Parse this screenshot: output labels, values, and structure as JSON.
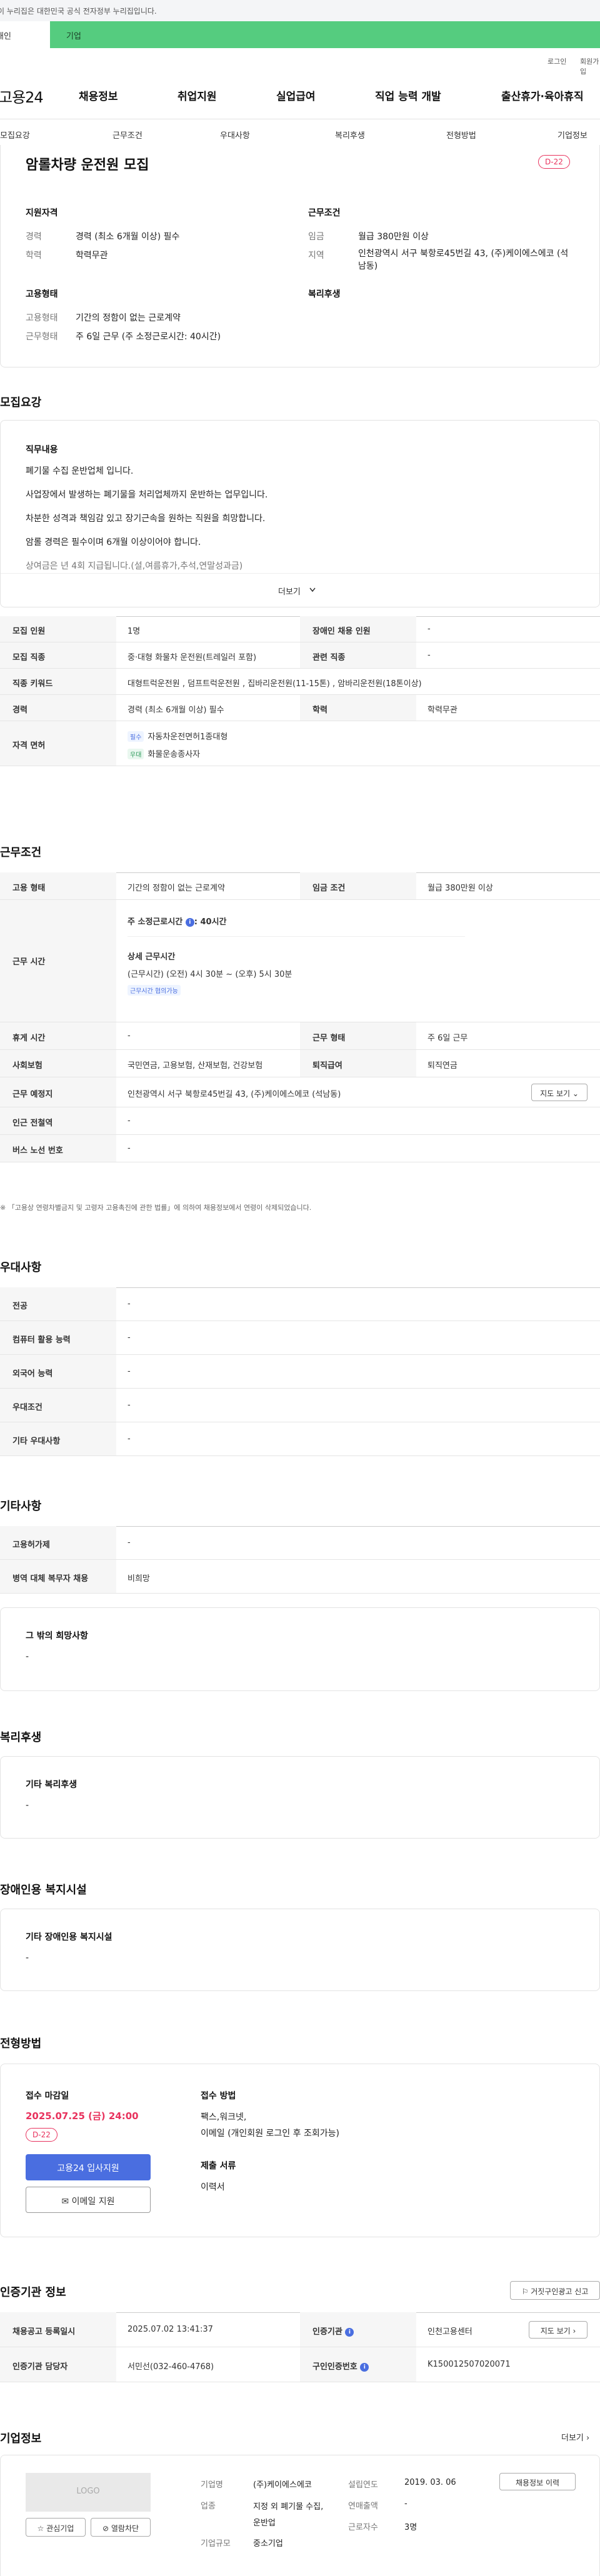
{
  "govbar": "이 누리집은 대한민국 공식 전자정부 누리집입니다.",
  "tabs": {
    "individual": "개인",
    "corporate": "기업"
  },
  "util": {
    "login": "로그인",
    "signup": "회원가입"
  },
  "gnb": {
    "logo": "고용24",
    "items": [
      "채용정보",
      "취업지원",
      "실업급여",
      "직업 능력 개발",
      "출산휴가·육아휴직"
    ]
  },
  "subnav": [
    "모집요강",
    "근무조건",
    "우대사항",
    "복리후생",
    "전형방법",
    "기업정보"
  ],
  "summary": {
    "title": "암롤차량 운전원 모집",
    "dday": "D-22",
    "qual_title": "지원자격",
    "career_label": "경력",
    "career_val": "경력 (최소 6개월 이상) 필수",
    "edu_label": "학력",
    "edu_val": "학력무관",
    "cond_title": "근무조건",
    "wage_label": "임금",
    "wage_val": "월급 380만원 이상",
    "area_label": "지역",
    "area_val": "인천광역시 서구 북항로45번길 43, (주)케이에스에코 (석남동)",
    "emp_title": "고용형태",
    "emp_label": "고용형태",
    "emp_val": "기간의 정함이 없는 근로계약",
    "work_label": "근무형태",
    "work_val": "주 6일 근무 (주 소정근로시간: 40시간)",
    "welfare_title": "복리후생"
  },
  "recruit": {
    "section": "모집요강",
    "duty_title": "직무내용",
    "duty_lines": [
      "폐기물 수집 운반업체 입니다.",
      "사업장에서 발생하는 폐기물을 처리업체까지 운반하는 업무입니다.",
      "차분한 성격과 책임감 있고 장기근속을 원하는 직원을 희망합니다.",
      "암롤 경력은 필수이며 6개월 이상이어야 합니다.",
      "상여금은 년 4회 지급됩니다.(설,여름휴가,추석,연말성과금)"
    ],
    "more": "더보기",
    "rows": [
      {
        "h1": "모집 인원",
        "v1": "1명",
        "h2": "장애인 채용 인원",
        "v2": "-"
      },
      {
        "h1": "모집 직종",
        "v1": "중·대형 화물차 운전원(트레일러 포함)",
        "h2": "관련 직종",
        "v2": "-"
      },
      {
        "h1": "직종 키워드",
        "v1": "대형트럭운전원 , 덤프트럭운전원 , 집바리운전원(11-15톤) , 암바리운전원(18톤이상)"
      },
      {
        "h1": "경력",
        "v1": "경력 (최소 6개월 이상) 필수",
        "h2": "학력",
        "v2": "학력무관"
      }
    ],
    "license_head": "자격 면허",
    "license": [
      {
        "tag": "필수",
        "name": "자동차운전면허1종대형"
      },
      {
        "tag": "우대",
        "name": "화물운송종사자"
      }
    ]
  },
  "work": {
    "section": "근무조건",
    "emp_h": "고용 형태",
    "emp_v": "기간의 정함이 없는 근로계약",
    "wage_h": "임금 조건",
    "wage_v": "월급 380만원 이상",
    "time_h": "근무 시간",
    "weekly": "주 소정근로시간",
    "weekly_v": ": 40시간",
    "detail_title": "상세 근무시간",
    "detail_v": "(근무시간) (오전) 4시 30분 ~ (오후) 5시 30분",
    "flex": "근무시간 협의가능",
    "rest_h": "휴게 시간",
    "rest_v": "-",
    "type_h": "근무 형태",
    "type_v": "주 6일 근무",
    "ins_h": "사회보험",
    "ins_v": "국민연금, 고용보험, 산재보험, 건강보험",
    "sev_h": "퇴직급여",
    "sev_v": "퇴직연금",
    "place_h": "근무 예정지",
    "place_v": "인천광역시 서구 북항로45번길 43, (주)케이에스에코 (석남동)",
    "map": "지도 보기",
    "subway_h": "인근 전철역",
    "subway_v": "-",
    "bus_h": "버스 노선 번호",
    "bus_v": "-",
    "note": "※ 「고용상 연령차별금지 및 고령자 고용촉진에 관한 법률」에 의하여 채용정보에서 연령이 삭제되었습니다."
  },
  "pref": {
    "section": "우대사항",
    "rows": [
      {
        "h": "전공",
        "v": "-"
      },
      {
        "h": "컴퓨터 활용 능력",
        "v": "-"
      },
      {
        "h": "외국어 능력",
        "v": "-"
      },
      {
        "h": "우대조건",
        "v": "-"
      },
      {
        "h": "기타 우대사항",
        "v": "-"
      }
    ]
  },
  "etc": {
    "section": "기타사항",
    "rows": [
      {
        "h": "고용허가제",
        "v": "-"
      },
      {
        "h": "병역 대체 복무자 채용",
        "v": "비희망"
      }
    ],
    "hope_title": "그 밖의 희망사항",
    "hope_v": "-"
  },
  "welfare": {
    "section": "복리후생",
    "title": "기타 복리후생",
    "v": "-"
  },
  "disab": {
    "section": "장애인용 복지시설",
    "title": "기타 장애인용 복지시설",
    "v": "-"
  },
  "method": {
    "section": "전형방법",
    "deadline_t": "접수 마감일",
    "deadline_v": "2025.07.25 (금) 24:00",
    "dday": "D-22",
    "apply": "고용24 입사지원",
    "email": "이메일 지원",
    "way_t": "접수 방법",
    "way_v1": "팩스,워크넷,",
    "way_v2": "이메일 (개인회원 로그인 후 조회가능)",
    "docs_t": "제출 서류",
    "docs_v": "이력서"
  },
  "agency": {
    "section": "인증기관 정보",
    "report": "거짓구인광고 신고",
    "reg_h": "채용공고 등록일시",
    "reg_v": "2025.07.02 13:41:37",
    "ag_h": "인증기관",
    "ag_v": "인천고용센터",
    "map": "지도 보기",
    "mgr_h": "인증기관 담당자",
    "mgr_v": "서민선(032-460-4768)",
    "no_h": "구인인증번호",
    "no_v": "K150012507020071"
  },
  "company": {
    "section": "기업정보",
    "more": "더보기",
    "logo": "LOGO",
    "fav": "관심기업",
    "block": "열람차단",
    "name_l": "기업명",
    "name_v": "(주)케이에스에코",
    "ind_l": "업종",
    "ind_v": "지정 외 폐기물 수집, 운반업",
    "size_l": "기업규모",
    "size_v": "중소기업",
    "est_l": "설립연도",
    "est_v": "2019. 03. 06",
    "sales_l": "연매출액",
    "sales_v": "-",
    "emp_l": "근로자수",
    "emp_v": "3명",
    "jobs": "채용정보 이력"
  }
}
